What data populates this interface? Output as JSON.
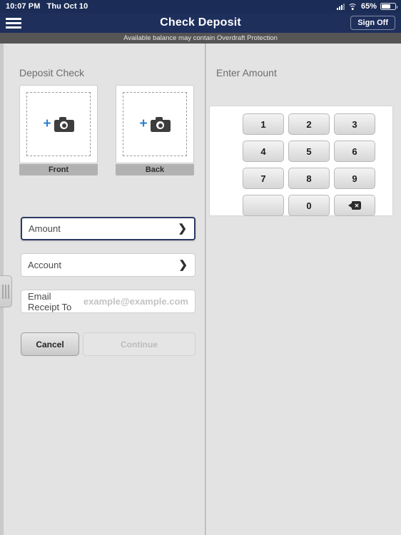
{
  "status_bar": {
    "time": "10:07 PM",
    "date": "Thu Oct 10",
    "signal_icon": "cellular-signal-icon",
    "wifi_icon": "wifi-icon",
    "battery_percent": "65%",
    "battery_icon": "battery-icon"
  },
  "nav": {
    "menu_icon": "hamburger-menu-icon",
    "title": "Check Deposit",
    "sign_off_label": "Sign Off"
  },
  "subtitle": {
    "text": "Available balance may contain Overdraft Protection"
  },
  "left_panel": {
    "section_title": "Deposit Check",
    "checks": [
      {
        "label": "Front",
        "plus": "+",
        "camera_icon": "camera-icon"
      },
      {
        "label": "Back",
        "plus": "+",
        "camera_icon": "camera-icon"
      }
    ],
    "fields": [
      {
        "label": "Amount",
        "value": "",
        "chevron": "❯",
        "focused": true
      },
      {
        "label": "Account",
        "value": "",
        "chevron": "❯",
        "focused": false
      }
    ],
    "email_field": {
      "label": "Email Receipt To",
      "value": "",
      "placeholder": "example@example.com"
    },
    "buttons": {
      "cancel_label": "Cancel",
      "continue_label": "Continue"
    },
    "drag_handle_icon": "drag-handle-icon"
  },
  "right_panel": {
    "section_title": "Enter Amount",
    "keypad": [
      {
        "key": "1",
        "type": "digit"
      },
      {
        "key": "2",
        "type": "digit"
      },
      {
        "key": "3",
        "type": "digit"
      },
      {
        "key": "4",
        "type": "digit"
      },
      {
        "key": "5",
        "type": "digit"
      },
      {
        "key": "6",
        "type": "digit"
      },
      {
        "key": "7",
        "type": "digit"
      },
      {
        "key": "8",
        "type": "digit"
      },
      {
        "key": "9",
        "type": "digit"
      },
      {
        "key": "",
        "type": "blank"
      },
      {
        "key": "0",
        "type": "digit"
      },
      {
        "key": "backspace-icon",
        "type": "backspace"
      }
    ]
  },
  "colors": {
    "status_bar_bg": "#1b2c56",
    "nav_bg": "#1e2f5c",
    "subtitle_bg": "#555555",
    "panel_bg": "#e3e3e3",
    "page_bg": "#c9c9c9",
    "accent_blue": "#2f7fd4",
    "focus_border": "#2a3a63"
  }
}
